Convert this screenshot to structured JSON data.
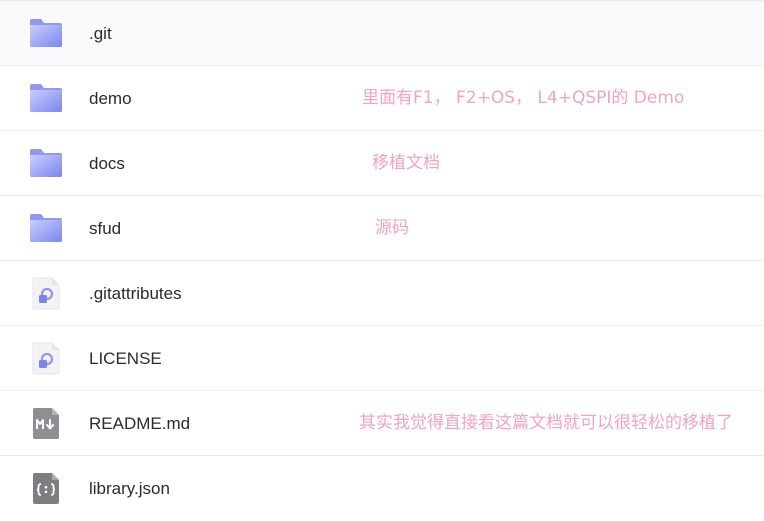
{
  "colors": {
    "folder_light": "#c7cdfb",
    "folder_dark": "#7c86f0",
    "annotation": "#f2a3c4",
    "text": "#2b2b2f",
    "divider": "#ececef"
  },
  "files": [
    {
      "name": ".git",
      "icon": "folder-icon",
      "note": ""
    },
    {
      "name": "demo",
      "icon": "folder-icon",
      "note": "里面有F1， F2+OS， L4+QSPI的 Demo"
    },
    {
      "name": "docs",
      "icon": "folder-icon",
      "note": "移植文档"
    },
    {
      "name": "sfud",
      "icon": "folder-icon",
      "note": "源码"
    },
    {
      "name": ".gitattributes",
      "icon": "generic-file-icon",
      "note": ""
    },
    {
      "name": "LICENSE",
      "icon": "generic-file-icon",
      "note": ""
    },
    {
      "name": "README.md",
      "icon": "markdown-file-icon",
      "note": "其实我觉得直接看这篇文档就可以很轻松的移植了"
    },
    {
      "name": "library.json",
      "icon": "json-file-icon",
      "note": ""
    }
  ]
}
